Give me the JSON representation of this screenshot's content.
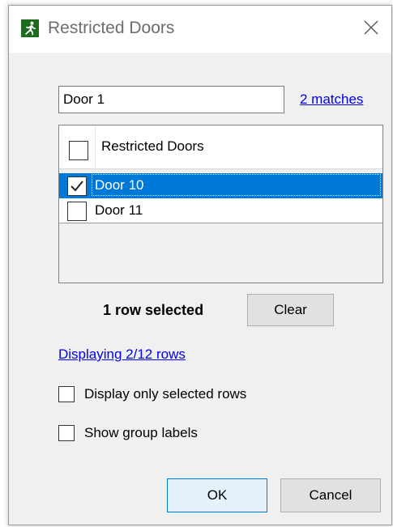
{
  "dialog": {
    "title": "Restricted Doors",
    "icon": "running-man-exit-icon",
    "accent_color": "#1e6b1e"
  },
  "search": {
    "value": "Door 1",
    "matches_label": "2 matches"
  },
  "list": {
    "header_label": "Restricted Doors",
    "header_checked": false,
    "rows": [
      {
        "label": "Door 10",
        "checked": true,
        "selected": true
      },
      {
        "label": "Door 11",
        "checked": false,
        "selected": false
      }
    ],
    "selection_color": "#0078d7"
  },
  "selection": {
    "count_label": "1 row selected",
    "clear_label": "Clear"
  },
  "displaying_label": "Displaying 2/12 rows",
  "options": {
    "display_only_selected": {
      "label": "Display only selected rows",
      "checked": false
    },
    "show_group_labels": {
      "label": "Show group labels",
      "checked": false
    }
  },
  "buttons": {
    "ok_label": "OK",
    "cancel_label": "Cancel"
  }
}
